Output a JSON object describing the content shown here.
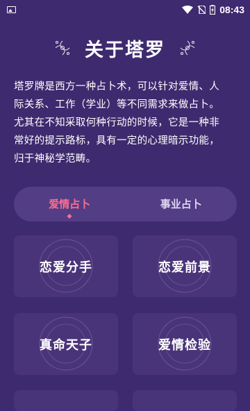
{
  "status_bar": {
    "time": "08:43"
  },
  "header": {
    "title": "关于塔罗"
  },
  "intro": {
    "lines": [
      "塔罗牌是西方一种占卜术，可以针对爱情、人",
      "际关系、工作（学业）等不同需求来做占卜。",
      "尤其在不知采取何种行动的时候，它是一种非",
      "常好的提示路标，具有一定的心理暗示功能，",
      "归于神秘学范畴。"
    ]
  },
  "tabs": [
    {
      "label": "爱情占卜",
      "active": true
    },
    {
      "label": "事业占卜",
      "active": false
    }
  ],
  "cards": [
    {
      "label": "恋爱分手"
    },
    {
      "label": "恋爱前景"
    },
    {
      "label": "真命天子"
    },
    {
      "label": "爱情检验"
    }
  ],
  "colors": {
    "background": "#3e2a6e",
    "card": "#4a3479",
    "tab_bar": "#533d85",
    "accent": "#ff6d8c"
  }
}
